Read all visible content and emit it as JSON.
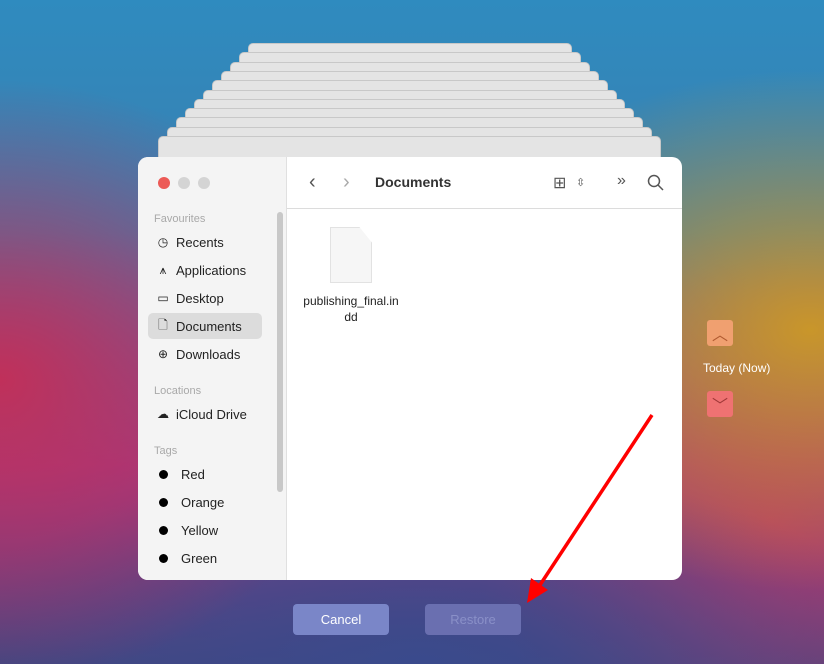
{
  "window": {
    "title": "Documents"
  },
  "sidebar": {
    "favourites_label": "Favourites",
    "favourites": [
      {
        "label": "Recents",
        "icon": "clock-icon"
      },
      {
        "label": "Applications",
        "icon": "applications-icon"
      },
      {
        "label": "Desktop",
        "icon": "desktop-icon"
      },
      {
        "label": "Documents",
        "icon": "document-icon",
        "selected": true
      },
      {
        "label": "Downloads",
        "icon": "download-icon"
      }
    ],
    "locations_label": "Locations",
    "locations": [
      {
        "label": "iCloud Drive",
        "icon": "cloud-icon"
      }
    ],
    "tags_label": "Tags",
    "tags": [
      {
        "label": "Red"
      },
      {
        "label": "Orange"
      },
      {
        "label": "Yellow"
      },
      {
        "label": "Green"
      }
    ]
  },
  "files": [
    {
      "name": "publishing_final.indd"
    }
  ],
  "timeline": {
    "label": "Today (Now)"
  },
  "buttons": {
    "cancel": "Cancel",
    "restore": "Restore"
  },
  "colors": {
    "annotation_arrow": "#ff0000",
    "close": "#ec5a56"
  }
}
